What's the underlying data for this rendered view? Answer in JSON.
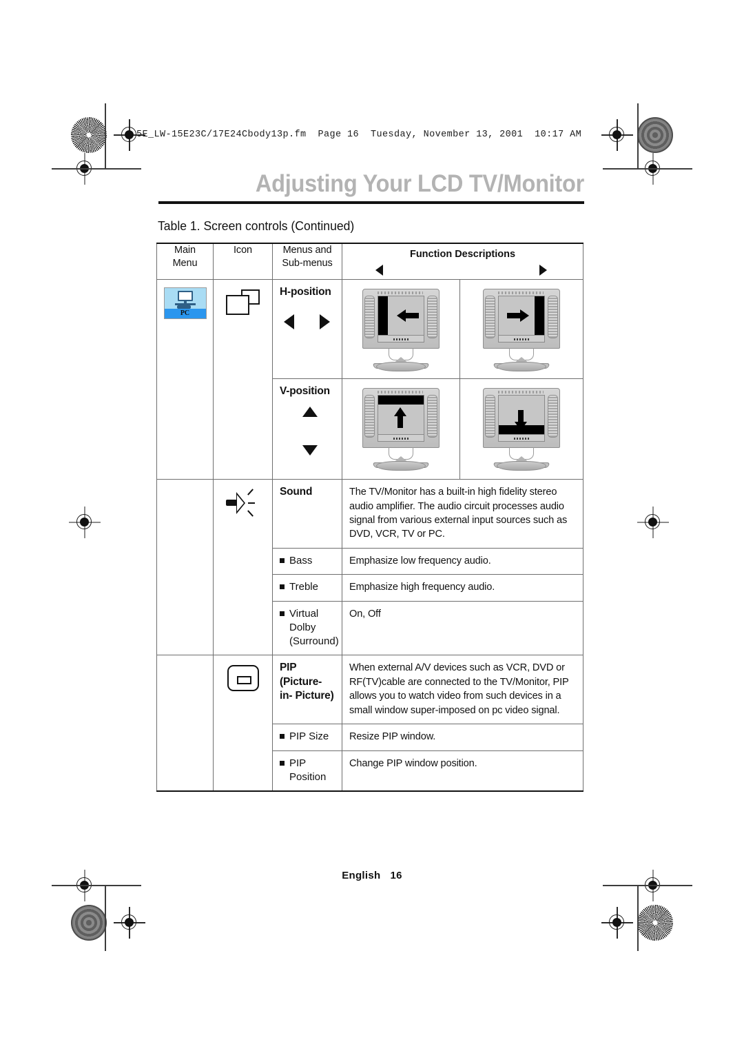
{
  "header": {
    "file_strip": "5E_LW-15E23C/17E24Cbody13p.fm  Page 16  Tuesday, November 13, 2001  10:17 AM",
    "page_title": "Adjusting Your LCD TV/Monitor"
  },
  "table": {
    "caption": "Table 1.  Screen controls (Continued)",
    "columns": {
      "main_menu": "Main\nMenu",
      "main_menu_line1": "Main",
      "main_menu_line2": "Menu",
      "icon": "Icon",
      "menus_line1": "Menus and",
      "menus_line2": "Sub-menus",
      "function_descriptions": "Function Descriptions"
    },
    "rows": {
      "pc": {
        "menu_icon_label": "PC",
        "icon_name": "overlapping-rectangles-icon",
        "h_position": {
          "label": "H-position",
          "left_arrow": "◄",
          "right_arrow": "►"
        },
        "v_position": {
          "label": "V-position",
          "up_arrow": "▲",
          "down_arrow": "▼"
        }
      },
      "sound": {
        "title": "Sound",
        "icon_name": "speaker-icon",
        "description": "The TV/Monitor has a built-in high fidelity stereo audio amplifier. The audio circuit processes audio signal from various external input sources such as DVD, VCR, TV or PC.",
        "sub_items": [
          {
            "label": "Bass",
            "description": "Emphasize low frequency audio."
          },
          {
            "label": "Treble",
            "description": "Emphasize high frequency audio."
          },
          {
            "label_line1": "Virtual",
            "label_line2": "Dolby",
            "label_line3": "(Surround)",
            "description": "On, Off"
          }
        ]
      },
      "pip": {
        "title_line1": "PIP",
        "title_line2": "(Picture-",
        "title_line3": "in- Picture)",
        "icon_name": "pip-icon",
        "description": "When external A/V devices such as VCR, DVD or RF(TV)cable are connected to the TV/Monitor, PIP allows you to watch video from such devices in a small window super-imposed on pc video signal.",
        "sub_items": [
          {
            "label": "PIP Size",
            "description": "Resize PIP window."
          },
          {
            "label_line1": "PIP",
            "label_line2": "Position",
            "description": "Change PIP window position."
          }
        ]
      }
    }
  },
  "footer": {
    "language": "English",
    "page_number": "16"
  },
  "colors": {
    "title_gray": "#b3b3b3",
    "rule_black": "#111111",
    "pc_icon_bg": "#a9dcf4",
    "pc_icon_band": "#2b96ee",
    "table_border": "#6e6e6e"
  }
}
